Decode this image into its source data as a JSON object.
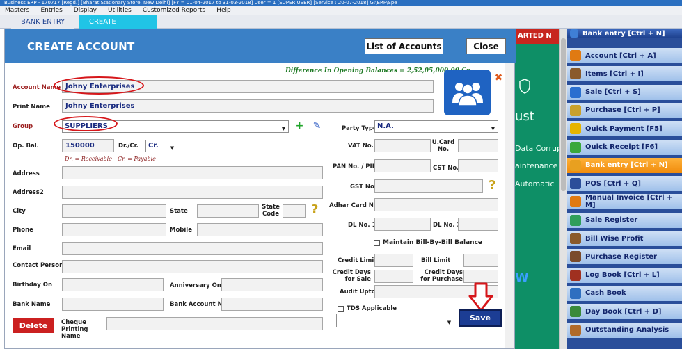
{
  "window": {
    "titlebar_text": "Business ERP - 170717 [Regd.] [Bharat Stationary Store, New Delhi] [FY = 01-04-2017 to 31-03-2018] User = 1 [SUPER USER] [Service : 20-07-2018] G:\\ERP\\Spe"
  },
  "menu": [
    "Masters",
    "Entries",
    "Display",
    "Utilities",
    "Customized Reports",
    "Help"
  ],
  "tabs": [
    {
      "label": "BANK ENTRY",
      "active": false
    },
    {
      "label": "CREATE ACCOUNT",
      "active": true
    }
  ],
  "background": {
    "banner": "ARTED N",
    "texts": [
      "ust",
      "Data Corrup",
      "aintenance",
      "Automatic",
      "W"
    ]
  },
  "dialog": {
    "title": "CREATE ACCOUNT",
    "list_button": "List of Accounts",
    "close_button": "Close",
    "difference_text": "Difference In Opening Balances = 2,52,05,000.00 Cr."
  },
  "form": {
    "account_name": {
      "label": "Account Name",
      "value": "Johny Enterprises"
    },
    "print_name": {
      "label": "Print Name",
      "value": "Johny Enterprises"
    },
    "group": {
      "label": "Group",
      "value": "SUPPLIERS"
    },
    "op_bal": {
      "label": "Op. Bal.",
      "value": "150000"
    },
    "drcr": {
      "label": "Dr./Cr.",
      "value": "Cr."
    },
    "hint_dr": "Dr. = Receivable",
    "hint_cr": "Cr. = Payable",
    "address": {
      "label": "Address",
      "value": ""
    },
    "address2": {
      "label": "Address2",
      "value": ""
    },
    "city": {
      "label": "City",
      "value": ""
    },
    "state": {
      "label": "State",
      "value": ""
    },
    "state_code": {
      "label": "State Code",
      "value": ""
    },
    "phone": {
      "label": "Phone",
      "value": ""
    },
    "mobile": {
      "label": "Mobile",
      "value": ""
    },
    "email": {
      "label": "Email",
      "value": ""
    },
    "contact_person": {
      "label": "Contact Person",
      "value": ""
    },
    "birthday_on": {
      "label": "Birthday On",
      "value": ""
    },
    "anniversary_on": {
      "label": "Anniversary On",
      "value": ""
    },
    "bank_name": {
      "label": "Bank Name",
      "value": ""
    },
    "bank_account_no": {
      "label": "Bank Account No.",
      "value": ""
    },
    "cheque_printing_name": {
      "label": "Cheque Printing Name",
      "value": ""
    },
    "party_type": {
      "label": "Party Type",
      "value": "N.A."
    },
    "vat_no": {
      "label": "VAT No.",
      "value": ""
    },
    "ucard_no": {
      "label": "U.Card No.",
      "value": ""
    },
    "pan_no": {
      "label": "PAN No. / PIN",
      "value": ""
    },
    "cst_no": {
      "label": "CST No.",
      "value": ""
    },
    "gst_no": {
      "label": "GST No.",
      "value": ""
    },
    "adhar_card_no": {
      "label": "Adhar Card No.",
      "value": ""
    },
    "dl_no1": {
      "label": "DL No. 1",
      "value": ""
    },
    "dl_no2": {
      "label": "DL No. 2",
      "value": ""
    },
    "maintain_bill": {
      "label": "Maintain Bill-By-Bill Balance",
      "checked": false
    },
    "credit_limit": {
      "label": "Credit Limit",
      "value": ""
    },
    "bill_limit": {
      "label": "Bill Limit",
      "value": ""
    },
    "credit_days_sale": {
      "label": "Credit Days for Sale",
      "value": ""
    },
    "credit_days_purchase": {
      "label": "Credit Days for Purchase",
      "value": ""
    },
    "audit_upto": {
      "label": "Audit Upto",
      "value": ""
    },
    "tds_applicable": {
      "label": "TDS Applicable",
      "checked": false
    },
    "tds_select": {
      "value": ""
    }
  },
  "buttons": {
    "delete": "Delete",
    "save": "Save"
  },
  "shortcuts": [
    {
      "label": "Bank entry [Ctrl + N]",
      "icon": "bank-icon",
      "variant": "head"
    },
    {
      "label": "Account [Ctrl + A]",
      "icon": "account-icon"
    },
    {
      "label": "Items [Ctrl + I]",
      "icon": "items-icon"
    },
    {
      "label": "Sale [Ctrl + S]",
      "icon": "sale-icon"
    },
    {
      "label": "Purchase [Ctrl + P]",
      "icon": "purchase-icon"
    },
    {
      "label": "Quick Payment [F5]",
      "icon": "payment-icon"
    },
    {
      "label": "Quick Receipt [F6]",
      "icon": "receipt-icon"
    },
    {
      "label": "Bank entry [Ctrl + N]",
      "icon": "bank-icon",
      "variant": "active"
    },
    {
      "label": "POS [Ctrl + Q]",
      "icon": "pos-icon"
    },
    {
      "label": "Manual Invoice [Ctrl + M]",
      "icon": "invoice-icon"
    },
    {
      "label": "Sale Register",
      "icon": "sale-register-icon"
    },
    {
      "label": "Bill Wise Profit",
      "icon": "profit-icon"
    },
    {
      "label": "Purchase Register",
      "icon": "purchase-register-icon"
    },
    {
      "label": "Log Book [Ctrl + L]",
      "icon": "log-book-icon"
    },
    {
      "label": "Cash Book",
      "icon": "cash-book-icon"
    },
    {
      "label": "Day Book [Ctrl + D]",
      "icon": "day-book-icon"
    },
    {
      "label": "Outstanding Analysis",
      "icon": "outstanding-icon"
    }
  ],
  "colors": {
    "dialog_header": "#3a80c6",
    "save_button": "#1c3d94",
    "delete_button": "#cb2020",
    "annotation_red": "#d6161a"
  }
}
